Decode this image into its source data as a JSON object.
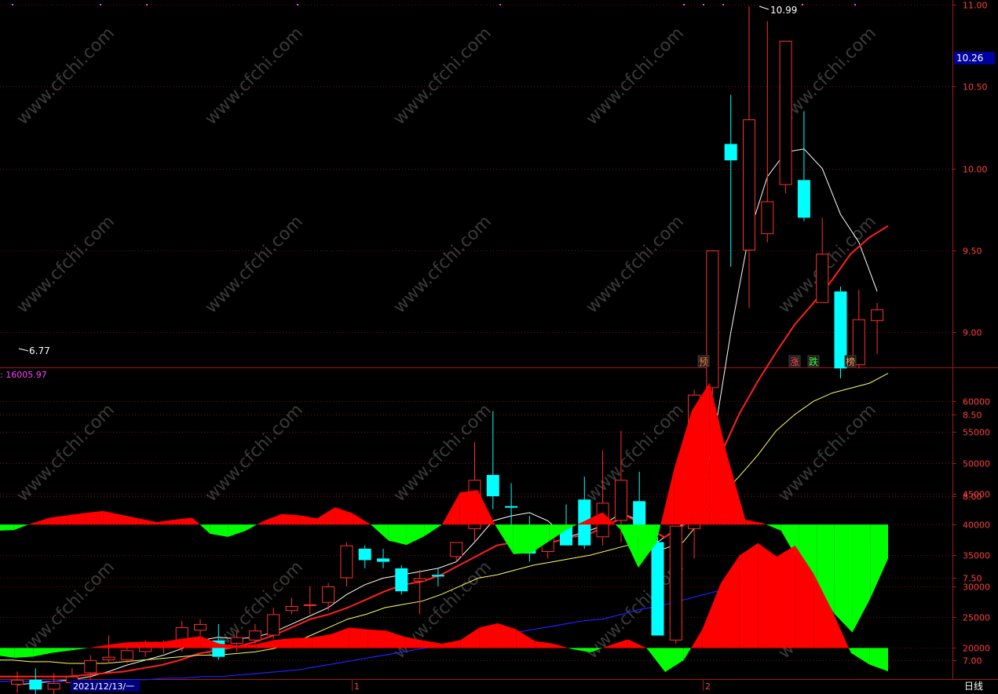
{
  "colors": {
    "background": "#000000",
    "axis_red": "#a01818",
    "grid_red": "#7a1010",
    "up_red": "#ff3030",
    "down_cyan": "#00ffff",
    "ma5_white": "#ffffff",
    "ma10_red": "#ff2020",
    "ma20_yellow": "#ffff60",
    "ma60_blue": "#2020ff",
    "fill_red": "#ff0000",
    "fill_green": "#00ff00",
    "magenta": "#ff40ff",
    "price_box": "#0000a0"
  },
  "main_panel": {
    "y_ticks": [
      "11.00",
      "10.50",
      "10.00",
      "9.50",
      "9.00",
      "8.50",
      "8.00",
      "7.50",
      "7.00"
    ],
    "current_price_label": "10.26",
    "high_label": "10.99",
    "low_label": "6.77",
    "markers": [
      {
        "text": "预",
        "color": "#ff8040"
      },
      {
        "text": "涨",
        "color": "#ff5050"
      },
      {
        "text": "跌",
        "color": "#40ff40"
      },
      {
        "text": "榜",
        "color": "#ffa060"
      }
    ]
  },
  "sub_panel": {
    "label": ": 16005.97",
    "y_ticks": [
      "60000",
      "55000",
      "50000",
      "45000",
      "40000",
      "35000",
      "30000",
      "25000",
      "20000"
    ]
  },
  "x_axis": {
    "date_label": "2021/12/13/一",
    "month_ticks": [
      "1",
      "2"
    ],
    "period_label": "日线"
  },
  "watermark": "www.cfchi.com",
  "chart_data": [
    {
      "type": "candlestick",
      "title": "",
      "ylim": [
        6.6,
        11.0
      ],
      "candles": [
        {
          "o": 6.85,
          "h": 6.93,
          "l": 6.8,
          "c": 6.88
        },
        {
          "o": 6.88,
          "h": 6.95,
          "l": 6.78,
          "c": 6.82
        },
        {
          "o": 6.82,
          "h": 6.92,
          "l": 6.77,
          "c": 6.86
        },
        {
          "o": 6.86,
          "h": 6.95,
          "l": 6.84,
          "c": 6.9
        },
        {
          "o": 6.92,
          "h": 7.03,
          "l": 6.88,
          "c": 7.0
        },
        {
          "o": 7.0,
          "h": 7.15,
          "l": 6.98,
          "c": 7.02
        },
        {
          "o": 7.0,
          "h": 7.08,
          "l": 6.98,
          "c": 7.06
        },
        {
          "o": 7.05,
          "h": 7.12,
          "l": 7.02,
          "c": 7.1
        },
        {
          "o": 7.08,
          "h": 7.12,
          "l": 7.04,
          "c": 7.09
        },
        {
          "o": 7.08,
          "h": 7.24,
          "l": 7.05,
          "c": 7.2
        },
        {
          "o": 7.18,
          "h": 7.25,
          "l": 7.15,
          "c": 7.22
        },
        {
          "o": 7.12,
          "h": 7.22,
          "l": 7.0,
          "c": 7.02
        },
        {
          "o": 7.1,
          "h": 7.18,
          "l": 7.05,
          "c": 7.14
        },
        {
          "o": 7.12,
          "h": 7.22,
          "l": 7.1,
          "c": 7.18
        },
        {
          "o": 7.15,
          "h": 7.32,
          "l": 7.13,
          "c": 7.28
        },
        {
          "o": 7.3,
          "h": 7.38,
          "l": 7.28,
          "c": 7.33
        },
        {
          "o": 7.33,
          "h": 7.45,
          "l": 7.28,
          "c": 7.34
        },
        {
          "o": 7.35,
          "h": 7.47,
          "l": 7.3,
          "c": 7.45
        },
        {
          "o": 7.5,
          "h": 7.72,
          "l": 7.45,
          "c": 7.7
        },
        {
          "o": 7.68,
          "h": 7.7,
          "l": 7.56,
          "c": 7.61
        },
        {
          "o": 7.62,
          "h": 7.68,
          "l": 7.56,
          "c": 7.6
        },
        {
          "o": 7.56,
          "h": 7.58,
          "l": 7.4,
          "c": 7.42
        },
        {
          "o": 7.48,
          "h": 7.55,
          "l": 7.28,
          "c": 7.5
        },
        {
          "o": 7.52,
          "h": 7.56,
          "l": 7.45,
          "c": 7.51
        },
        {
          "o": 7.63,
          "h": 7.72,
          "l": 7.6,
          "c": 7.72
        },
        {
          "o": 7.8,
          "h": 8.33,
          "l": 7.72,
          "c": 8.1
        },
        {
          "o": 8.13,
          "h": 8.52,
          "l": 7.92,
          "c": 8.0
        },
        {
          "o": 7.94,
          "h": 8.08,
          "l": 7.72,
          "c": 7.93
        },
        {
          "o": 7.82,
          "h": 7.88,
          "l": 7.6,
          "c": 7.65
        },
        {
          "o": 7.66,
          "h": 7.83,
          "l": 7.62,
          "c": 7.78
        },
        {
          "o": 7.82,
          "h": 7.95,
          "l": 7.7,
          "c": 7.7
        },
        {
          "o": 7.98,
          "h": 8.12,
          "l": 7.68,
          "c": 7.7
        },
        {
          "o": 7.75,
          "h": 8.28,
          "l": 7.7,
          "c": 7.96
        },
        {
          "o": 7.85,
          "h": 8.4,
          "l": 7.72,
          "c": 8.1
        },
        {
          "o": 7.97,
          "h": 8.15,
          "l": 7.68,
          "c": 7.75
        },
        {
          "o": 7.72,
          "h": 7.75,
          "l": 7.15,
          "c": 7.15
        },
        {
          "o": 7.12,
          "h": 7.82,
          "l": 7.1,
          "c": 7.82
        },
        {
          "o": 7.8,
          "h": 8.65,
          "l": 7.62,
          "c": 8.62
        },
        {
          "o": 8.66,
          "h": 9.5,
          "l": 8.62,
          "c": 9.5
        },
        {
          "o": 10.15,
          "h": 10.45,
          "l": 9.4,
          "c": 10.05
        },
        {
          "o": 9.5,
          "h": 10.99,
          "l": 9.15,
          "c": 10.3
        },
        {
          "o": 9.6,
          "h": 10.9,
          "l": 9.55,
          "c": 9.8
        },
        {
          "o": 9.9,
          "h": 10.78,
          "l": 9.85,
          "c": 10.78
        },
        {
          "o": 9.93,
          "h": 10.35,
          "l": 9.68,
          "c": 9.7
        },
        {
          "o": 9.18,
          "h": 9.7,
          "l": 9.18,
          "c": 9.48
        },
        {
          "o": 9.25,
          "h": 9.28,
          "l": 8.72,
          "c": 8.78
        },
        {
          "o": 8.8,
          "h": 9.26,
          "l": 8.78,
          "c": 9.08
        },
        {
          "o": 9.07,
          "h": 9.18,
          "l": 8.87,
          "c": 9.14
        }
      ],
      "series": [
        {
          "values": [
            6.85,
            6.86,
            6.87,
            6.88,
            6.9,
            6.93,
            6.97,
            7.0,
            7.03,
            7.07,
            7.12,
            7.14,
            7.13,
            7.14,
            7.17,
            7.22,
            7.27,
            7.32,
            7.4,
            7.46,
            7.5,
            7.52,
            7.54,
            7.56,
            7.6,
            7.72,
            7.85,
            7.88,
            7.9,
            7.85,
            7.75,
            7.78,
            7.82,
            7.9,
            7.85,
            7.72,
            7.8,
            7.88,
            8.3,
            9.0,
            9.6,
            9.95,
            10.1,
            10.12,
            10.0,
            9.72,
            9.55,
            9.25
          ]
        },
        {
          "values": [
            6.9,
            6.9,
            6.9,
            6.9,
            6.9,
            6.91,
            6.92,
            6.93,
            6.95,
            6.97,
            7.0,
            7.04,
            7.06,
            7.08,
            7.11,
            7.15,
            7.2,
            7.25,
            7.28,
            7.32,
            7.37,
            7.42,
            7.46,
            7.48,
            7.52,
            7.58,
            7.64,
            7.7,
            7.72,
            7.7,
            7.72,
            7.75,
            7.77,
            7.83,
            7.88,
            7.81,
            7.75,
            7.82,
            8.02,
            8.25,
            8.5,
            8.7,
            8.88,
            9.05,
            9.18,
            9.32,
            9.48,
            9.58,
            9.65
          ]
        },
        {
          "values": [
            7.0,
            7.0,
            6.99,
            6.99,
            6.98,
            6.98,
            6.98,
            6.99,
            7.0,
            7.01,
            7.02,
            7.03,
            7.03,
            7.04,
            7.05,
            7.07,
            7.1,
            7.15,
            7.2,
            7.25,
            7.28,
            7.32,
            7.34,
            7.36,
            7.4,
            7.45,
            7.5,
            7.52,
            7.55,
            7.58,
            7.6,
            7.62,
            7.64,
            7.67,
            7.7,
            7.69,
            7.68,
            7.72,
            7.86,
            8.0,
            8.12,
            8.25,
            8.4,
            8.5,
            8.58,
            8.63,
            8.66,
            8.69,
            8.75
          ]
        },
        {
          "values": [
            6.87,
            6.87,
            6.87,
            6.87,
            6.87,
            6.87,
            6.88,
            6.88,
            6.88,
            6.89,
            6.89,
            6.9,
            6.9,
            6.91,
            6.92,
            6.93,
            6.94,
            6.96,
            6.98,
            7.0,
            7.02,
            7.04,
            7.06,
            7.08,
            7.1,
            7.12,
            7.14,
            7.16,
            7.18,
            7.2,
            7.22,
            7.24,
            7.25,
            7.28,
            7.31,
            7.33,
            7.36,
            7.39,
            7.42,
            7.46,
            7.51,
            7.55,
            7.58,
            7.61,
            7.64,
            7.67,
            7.7,
            7.73
          ]
        }
      ]
    },
    {
      "type": "area",
      "title": "",
      "ylim": [
        14000,
        66000
      ],
      "baselines": [
        40000,
        20000
      ],
      "series": [
        {
          "values": [
            39000,
            39100,
            40200,
            41100,
            41500,
            41900,
            42200,
            41600,
            41000,
            40400,
            40800,
            41100,
            38500,
            38000,
            39000,
            40600,
            41700,
            41500,
            41000,
            42800,
            41800,
            40000,
            37400,
            36700,
            38100,
            40000,
            45200,
            45600,
            39800,
            35200,
            35400,
            37300,
            39200,
            40600,
            42000,
            39200,
            33000,
            37000,
            49000,
            58500,
            63000,
            51000,
            40800,
            40200,
            39000,
            34000,
            30000,
            25500,
            22500,
            28000,
            34500
          ]
        },
        {
          "values": [
            18800,
            18400,
            18600,
            19200,
            19600,
            20000,
            20500,
            20900,
            21000,
            21000,
            21500,
            21900,
            20700,
            20400,
            20600,
            21300,
            21600,
            21700,
            22200,
            23300,
            23000,
            22800,
            21800,
            21200,
            20700,
            21300,
            23300,
            24000,
            23000,
            21100,
            20700,
            19800,
            19300,
            20400,
            21400,
            20000,
            16100,
            18000,
            23000,
            30500,
            35000,
            37000,
            34800,
            36600,
            32000,
            26000,
            19200,
            17300,
            16200
          ]
        }
      ]
    }
  ]
}
